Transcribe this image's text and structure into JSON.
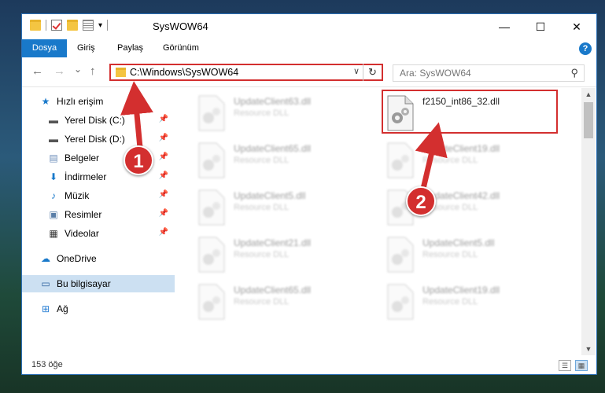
{
  "window": {
    "title": "SysWOW64",
    "minimize_glyph": "—",
    "maximize_glyph": "☐",
    "close_glyph": "✕"
  },
  "ribbon": {
    "tabs": [
      {
        "label": "Dosya",
        "active": true
      },
      {
        "label": "Giriş"
      },
      {
        "label": "Paylaş"
      },
      {
        "label": "Görünüm"
      }
    ],
    "help_glyph": "?"
  },
  "navigation": {
    "back_glyph": "←",
    "forward_glyph": "→",
    "recent_glyph": "⌄",
    "up_glyph": "↑",
    "address_path": "C:\\Windows\\SysWOW64",
    "address_dropdown_glyph": "∨",
    "refresh_glyph": "↻",
    "search_placeholder": "Ara: SysWOW64",
    "search_icon_glyph": "⚲"
  },
  "sidebar": {
    "items": [
      {
        "label": "Hızlı erişim",
        "icon": "star-icon",
        "glyph": "★",
        "color": "#1979ca"
      },
      {
        "label": "Yerel Disk (C:)",
        "icon": "drive-icon",
        "glyph": "▬",
        "pinned": true
      },
      {
        "label": "Yerel Disk (D:)",
        "icon": "drive-icon",
        "glyph": "▬",
        "pinned": true
      },
      {
        "label": "Belgeler",
        "icon": "document-icon",
        "glyph": "▤",
        "pinned": true
      },
      {
        "label": "İndirmeler",
        "icon": "download-icon",
        "glyph": "⬇",
        "pinned": true
      },
      {
        "label": "Müzik",
        "icon": "music-icon",
        "glyph": "♪",
        "pinned": true
      },
      {
        "label": "Resimler",
        "icon": "picture-icon",
        "glyph": "▣",
        "pinned": true
      },
      {
        "label": "Videolar",
        "icon": "video-icon",
        "glyph": "▦",
        "pinned": true
      },
      {
        "label": "OneDrive",
        "icon": "cloud-icon",
        "glyph": "☁"
      },
      {
        "label": "Bu bilgisayar",
        "icon": "computer-icon",
        "glyph": "▭",
        "selected": true
      },
      {
        "label": "Ağ",
        "icon": "network-icon",
        "glyph": "⊞"
      }
    ],
    "pin_glyph": "📌"
  },
  "files": [
    {
      "name": "UpdateClient63.dll",
      "type": "Resource DLL",
      "blurred": true
    },
    {
      "name": "f2150_int86_32.dll",
      "type": "",
      "highlighted": true
    },
    {
      "name": "UpdateClient65.dll",
      "type": "Resource DLL",
      "blurred": true
    },
    {
      "name": "UpdateClient19.dll",
      "type": "Resource DLL",
      "blurred": true
    },
    {
      "name": "UpdateClient5.dll",
      "type": "Resource DLL",
      "blurred": true
    },
    {
      "name": "UpdateClient42.dll",
      "type": "Resource DLL",
      "blurred": true
    },
    {
      "name": "UpdateClient21.dll",
      "type": "Resource DLL",
      "blurred": true
    },
    {
      "name": "UpdateClient5.dll",
      "type": "Resource DLL",
      "blurred": true
    },
    {
      "name": "UpdateClient65.dll",
      "type": "Resource DLL",
      "blurred": true
    },
    {
      "name": "UpdateClient19.dll",
      "type": "Resource DLL",
      "blurred": true
    }
  ],
  "status": {
    "item_count": "153 öğe"
  },
  "annotations": {
    "badge1": "1",
    "badge2": "2",
    "color": "#d32f2f"
  },
  "colors": {
    "accent": "#1979ca",
    "annotation": "#d32f2f",
    "selection": "#cce0f2"
  }
}
